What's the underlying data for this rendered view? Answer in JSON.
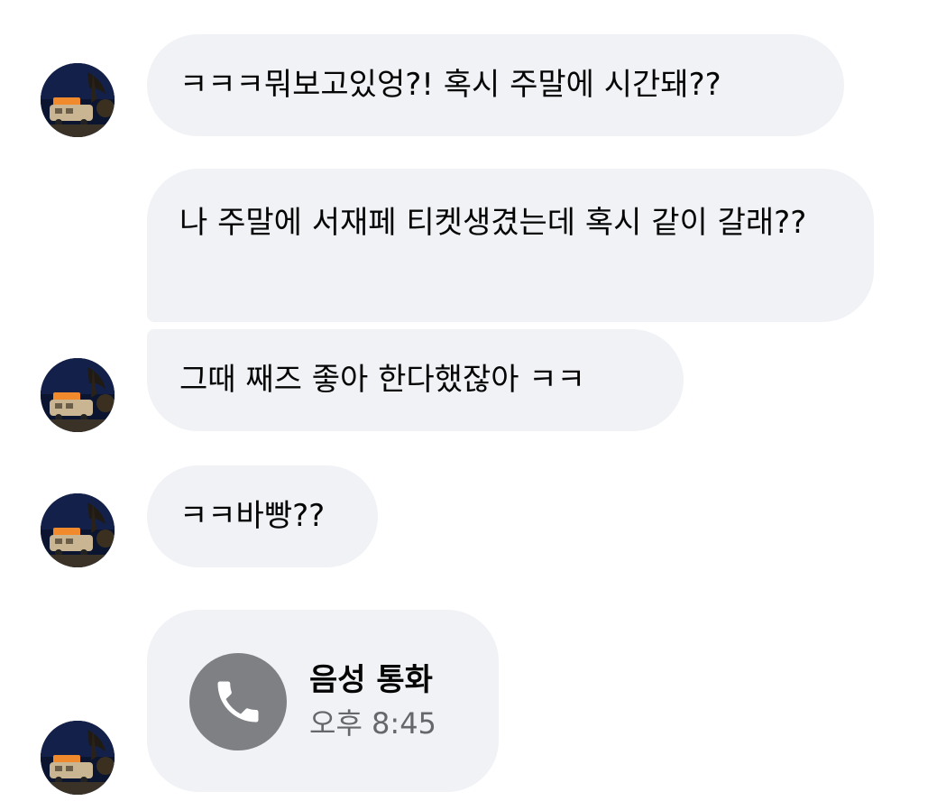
{
  "messages": [
    {
      "text": "ㅋㅋㅋ뭐보고있엉?! 혹시 주말에 시간돼??"
    },
    {
      "text": "나 주말에 서재페 티켓생겼는데 혹시 같이 갈래??"
    },
    {
      "text": "그때 째즈 좋아 한다했잖아 ㅋㅋ"
    },
    {
      "text": "ㅋㅋ바빵??"
    }
  ],
  "call": {
    "title": "음성 통화",
    "time": "오후 8:45",
    "icon": "phone-icon"
  },
  "avatar": {
    "icon": "avatar-photo"
  },
  "colors": {
    "bubble": "#f0f2f5",
    "call_icon_bg": "#7e8084",
    "secondary_text": "#65676b",
    "text": "#050505"
  }
}
